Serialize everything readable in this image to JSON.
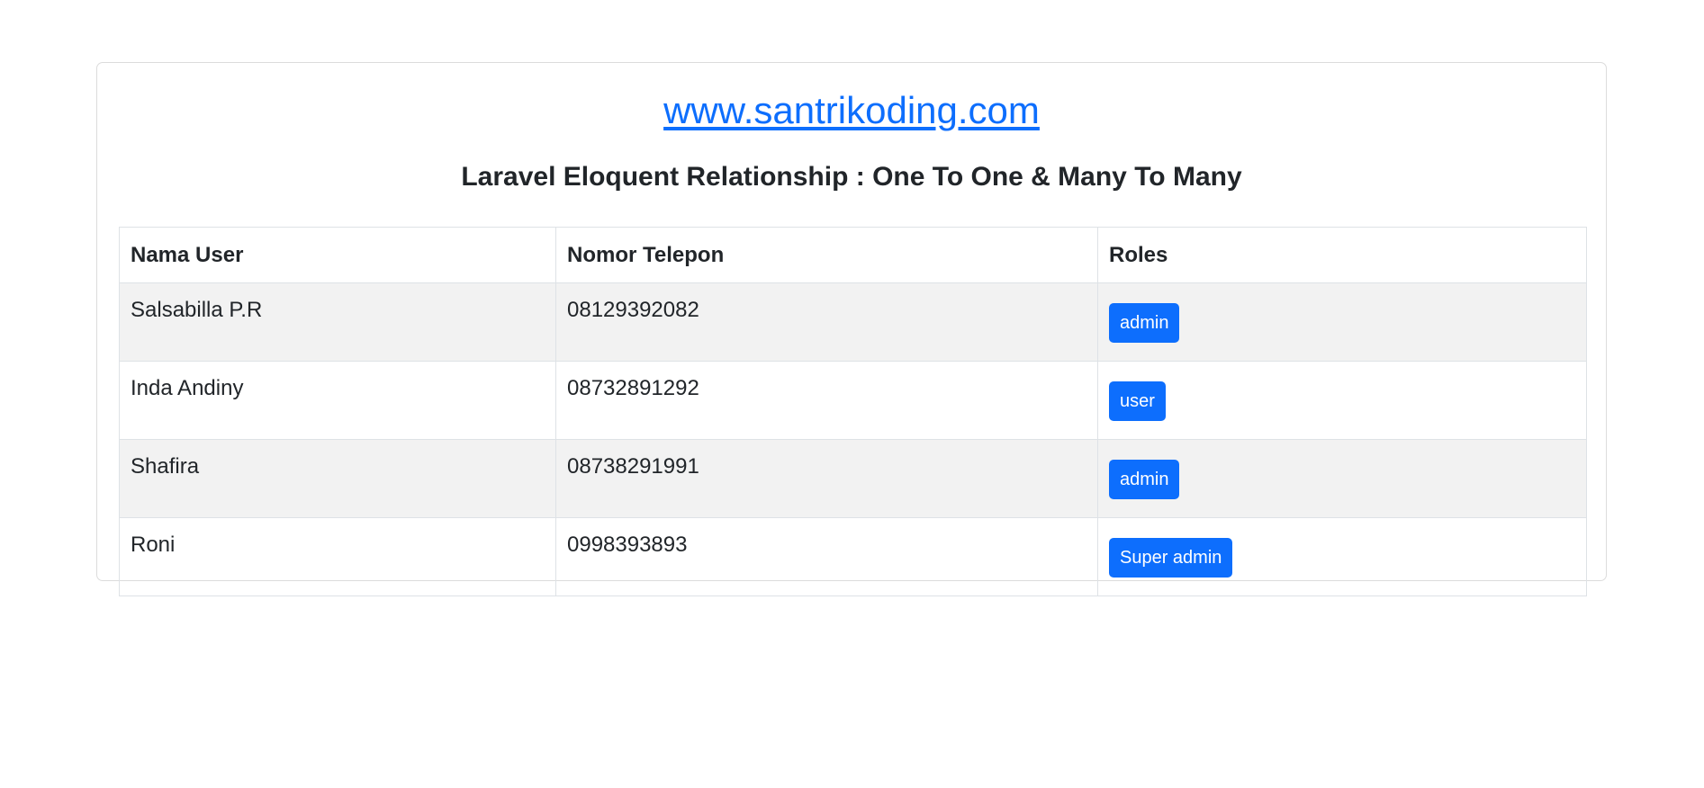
{
  "header": {
    "site_link": "www.santrikoding.com",
    "subtitle": "Laravel Eloquent Relationship : One To One & Many To Many"
  },
  "table": {
    "columns": [
      "Nama User",
      "Nomor Telepon",
      "Roles"
    ],
    "rows": [
      {
        "name": "Salsabilla P.R",
        "phone": "08129392082",
        "role": "admin"
      },
      {
        "name": "Inda Andiny",
        "phone": "08732891292",
        "role": "user"
      },
      {
        "name": "Shafira",
        "phone": "08738291991",
        "role": "admin"
      },
      {
        "name": "Roni",
        "phone": "0998393893",
        "role": "Super admin"
      }
    ]
  },
  "colors": {
    "link": "#0d6efd",
    "badge_bg": "#0d6efd",
    "badge_text": "#ffffff",
    "striped_row": "#f2f2f2",
    "border": "#dee2e6"
  }
}
